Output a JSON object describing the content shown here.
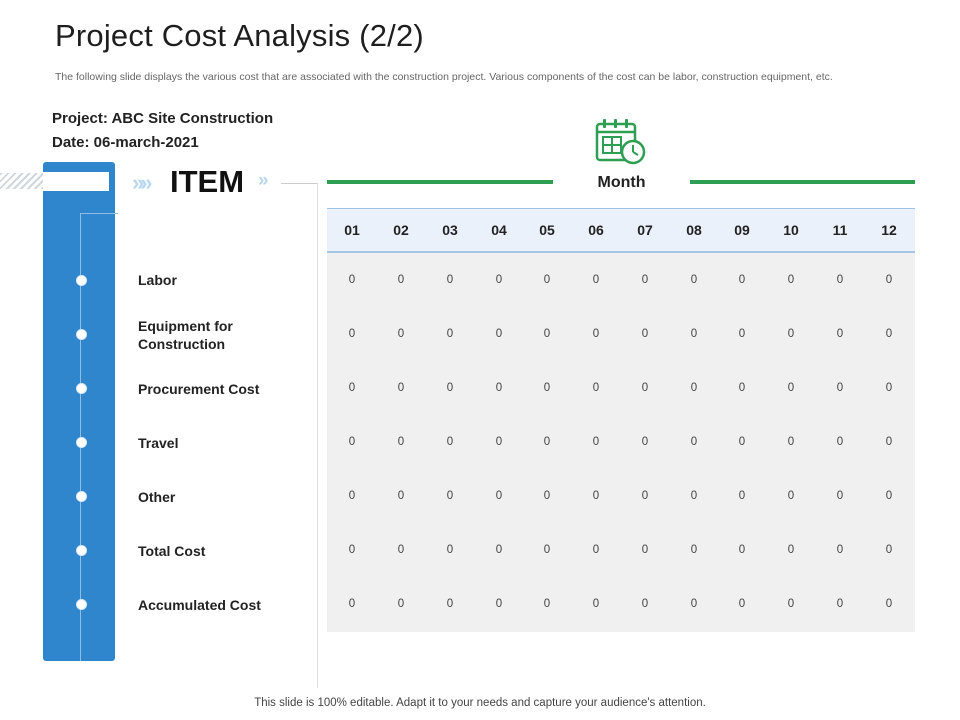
{
  "title": "Project Cost Analysis (2/2)",
  "subtitle": "The following slide displays the various cost that are associated with the construction project. Various components of the cost can be labor, construction equipment, etc.",
  "project_line": "Project:  ABC Site Construction",
  "date_line": "Date:  06-march-2021",
  "item_header": "ITEM",
  "month_header": "Month",
  "chevrons_left": "»»",
  "chevrons_right": "»",
  "colors": {
    "accent_blue": "#2f86cc",
    "accent_green": "#2e9e52"
  },
  "icons": {
    "calendar": "calendar-clock-icon"
  },
  "table": {
    "months": [
      "01",
      "02",
      "03",
      "04",
      "05",
      "06",
      "07",
      "08",
      "09",
      "10",
      "11",
      "12"
    ],
    "rows": [
      {
        "label": "Labor",
        "values": [
          "0",
          "0",
          "0",
          "0",
          "0",
          "0",
          "0",
          "0",
          "0",
          "0",
          "0",
          "0"
        ]
      },
      {
        "label": "Equipment for Construction",
        "values": [
          "0",
          "0",
          "0",
          "0",
          "0",
          "0",
          "0",
          "0",
          "0",
          "0",
          "0",
          "0"
        ]
      },
      {
        "label": "Procurement Cost",
        "values": [
          "0",
          "0",
          "0",
          "0",
          "0",
          "0",
          "0",
          "0",
          "0",
          "0",
          "0",
          "0"
        ]
      },
      {
        "label": "Travel",
        "values": [
          "0",
          "0",
          "0",
          "0",
          "0",
          "0",
          "0",
          "0",
          "0",
          "0",
          "0",
          "0"
        ]
      },
      {
        "label": "Other",
        "values": [
          "0",
          "0",
          "0",
          "0",
          "0",
          "0",
          "0",
          "0",
          "0",
          "0",
          "0",
          "0"
        ]
      },
      {
        "label": "Total Cost",
        "values": [
          "0",
          "0",
          "0",
          "0",
          "0",
          "0",
          "0",
          "0",
          "0",
          "0",
          "0",
          "0"
        ]
      },
      {
        "label": "Accumulated Cost",
        "values": [
          "0",
          "0",
          "0",
          "0",
          "0",
          "0",
          "0",
          "0",
          "0",
          "0",
          "0",
          "0"
        ]
      }
    ]
  },
  "footer": "This slide is 100% editable. Adapt it to your needs and capture your audience's attention."
}
